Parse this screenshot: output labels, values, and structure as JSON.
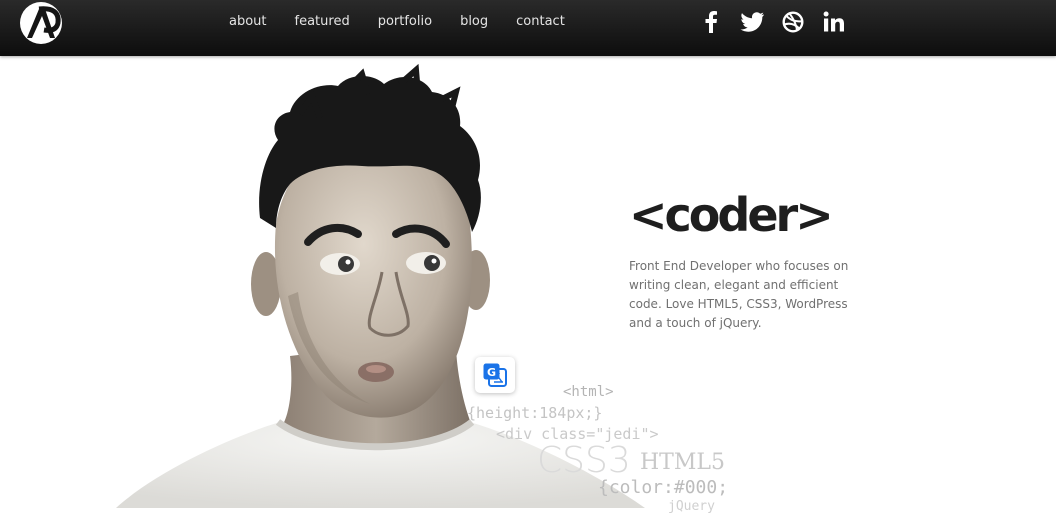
{
  "nav": {
    "links": [
      "about",
      "featured",
      "portfolio",
      "blog",
      "contact"
    ]
  },
  "social": {
    "icons": [
      "facebook-icon",
      "twitter-icon",
      "dribbble-icon",
      "linkedin-icon"
    ]
  },
  "hero": {
    "title": "<coder>",
    "bio": "Front End Developer who focuses on writing clean, elegant and efficient code. Love HTML5, CSS3, WordPress and a touch of jQuery.",
    "code_lines": [
      "<html>",
      "{height:184px;}",
      "<div class=\"jedi\">",
      "CSS3",
      "HTML5",
      "{color:#000;",
      "jQuery"
    ]
  },
  "colors": {
    "navbar": "#141414",
    "nav_text": "#e4e4e4",
    "title": "#1e1e1e",
    "bio_text": "#707070",
    "translate_blue": "#1a73e8"
  }
}
